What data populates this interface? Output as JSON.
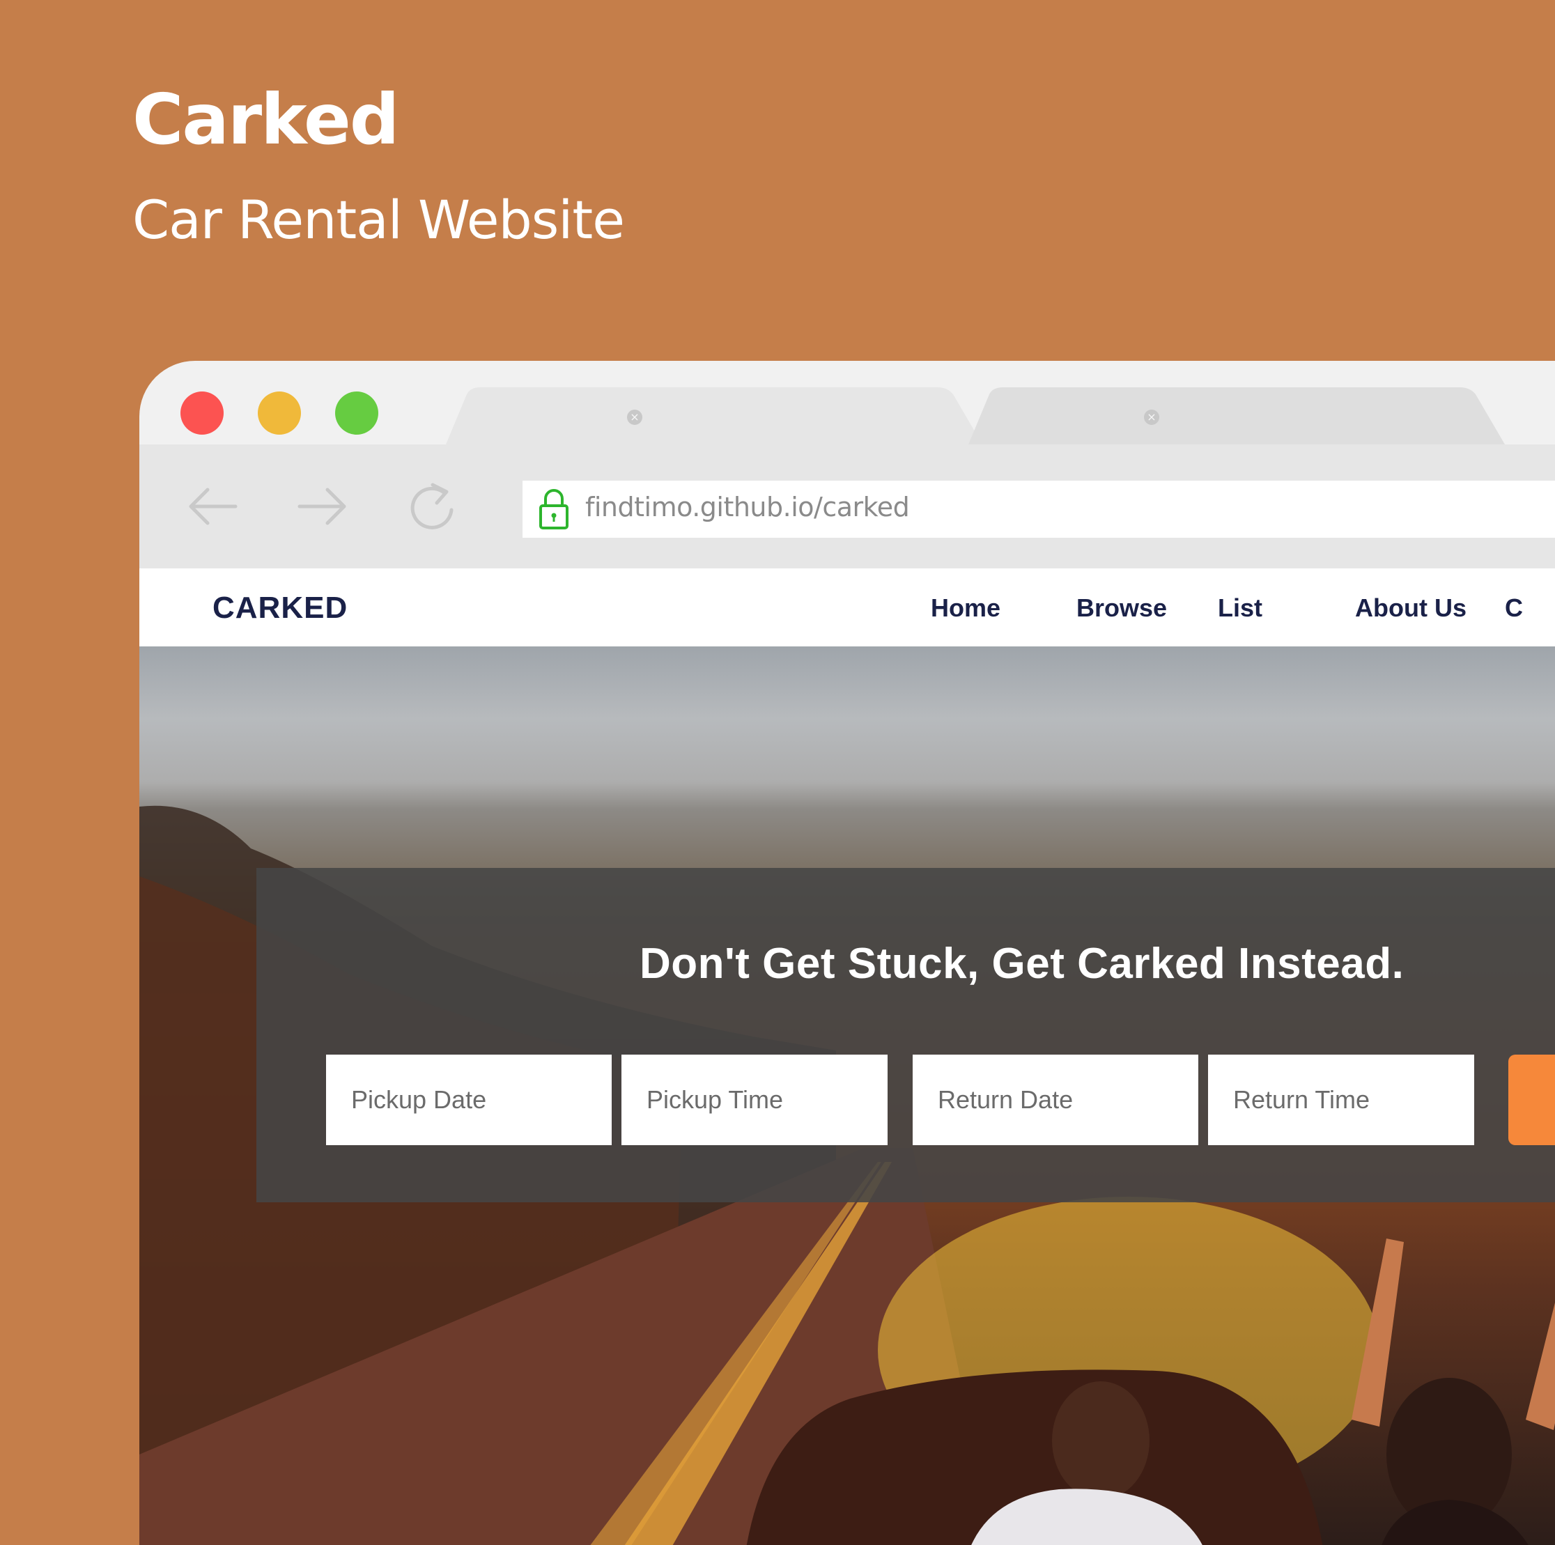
{
  "promo": {
    "title": "Carked",
    "subtitle": "Car Rental Website"
  },
  "browser": {
    "tabs": [
      {
        "close_glyph": "×"
      },
      {
        "close_glyph": "×"
      }
    ],
    "url": "findtimo.github.io/carked",
    "icons": [
      "back-arrow-icon",
      "forward-arrow-icon",
      "reload-icon",
      "lock-icon"
    ]
  },
  "site": {
    "logo": "CARKED",
    "nav": [
      "Home",
      "Browse",
      "List",
      "About Us",
      "C"
    ],
    "hero": {
      "headline": "Don't Get Stuck, Get Carked Instead.",
      "fields": {
        "pickup_date": "Pickup Date",
        "pickup_time": "Pickup Time",
        "return_date": "Return Date",
        "return_time": "Return Time"
      }
    }
  },
  "colors": {
    "background": "#c57e4a",
    "brand_navy": "#1a2148",
    "accent_orange": "#f6883a",
    "traffic_red": "#fc5351",
    "traffic_yellow": "#f0b93a",
    "traffic_green": "#66cc41",
    "lock_green": "#2db52d"
  }
}
